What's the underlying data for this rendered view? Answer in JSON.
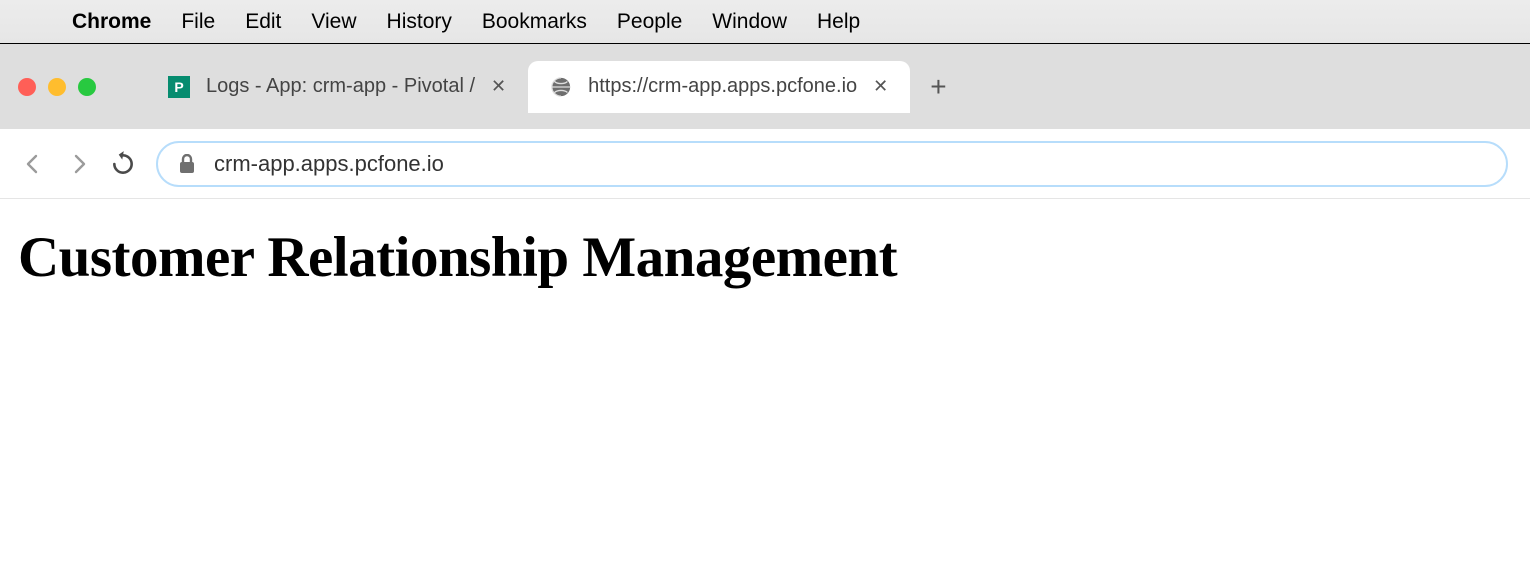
{
  "menubar": {
    "app": "Chrome",
    "items": [
      "File",
      "Edit",
      "View",
      "History",
      "Bookmarks",
      "People",
      "Window",
      "Help"
    ]
  },
  "tabs": [
    {
      "title": "Logs - App: crm-app - Pivotal /",
      "favicon_letter": "P",
      "active": false
    },
    {
      "title": "https://crm-app.apps.pcfone.io",
      "active": true
    }
  ],
  "toolbar": {
    "url": "crm-app.apps.pcfone.io"
  },
  "page": {
    "heading": "Customer Relationship Management"
  }
}
